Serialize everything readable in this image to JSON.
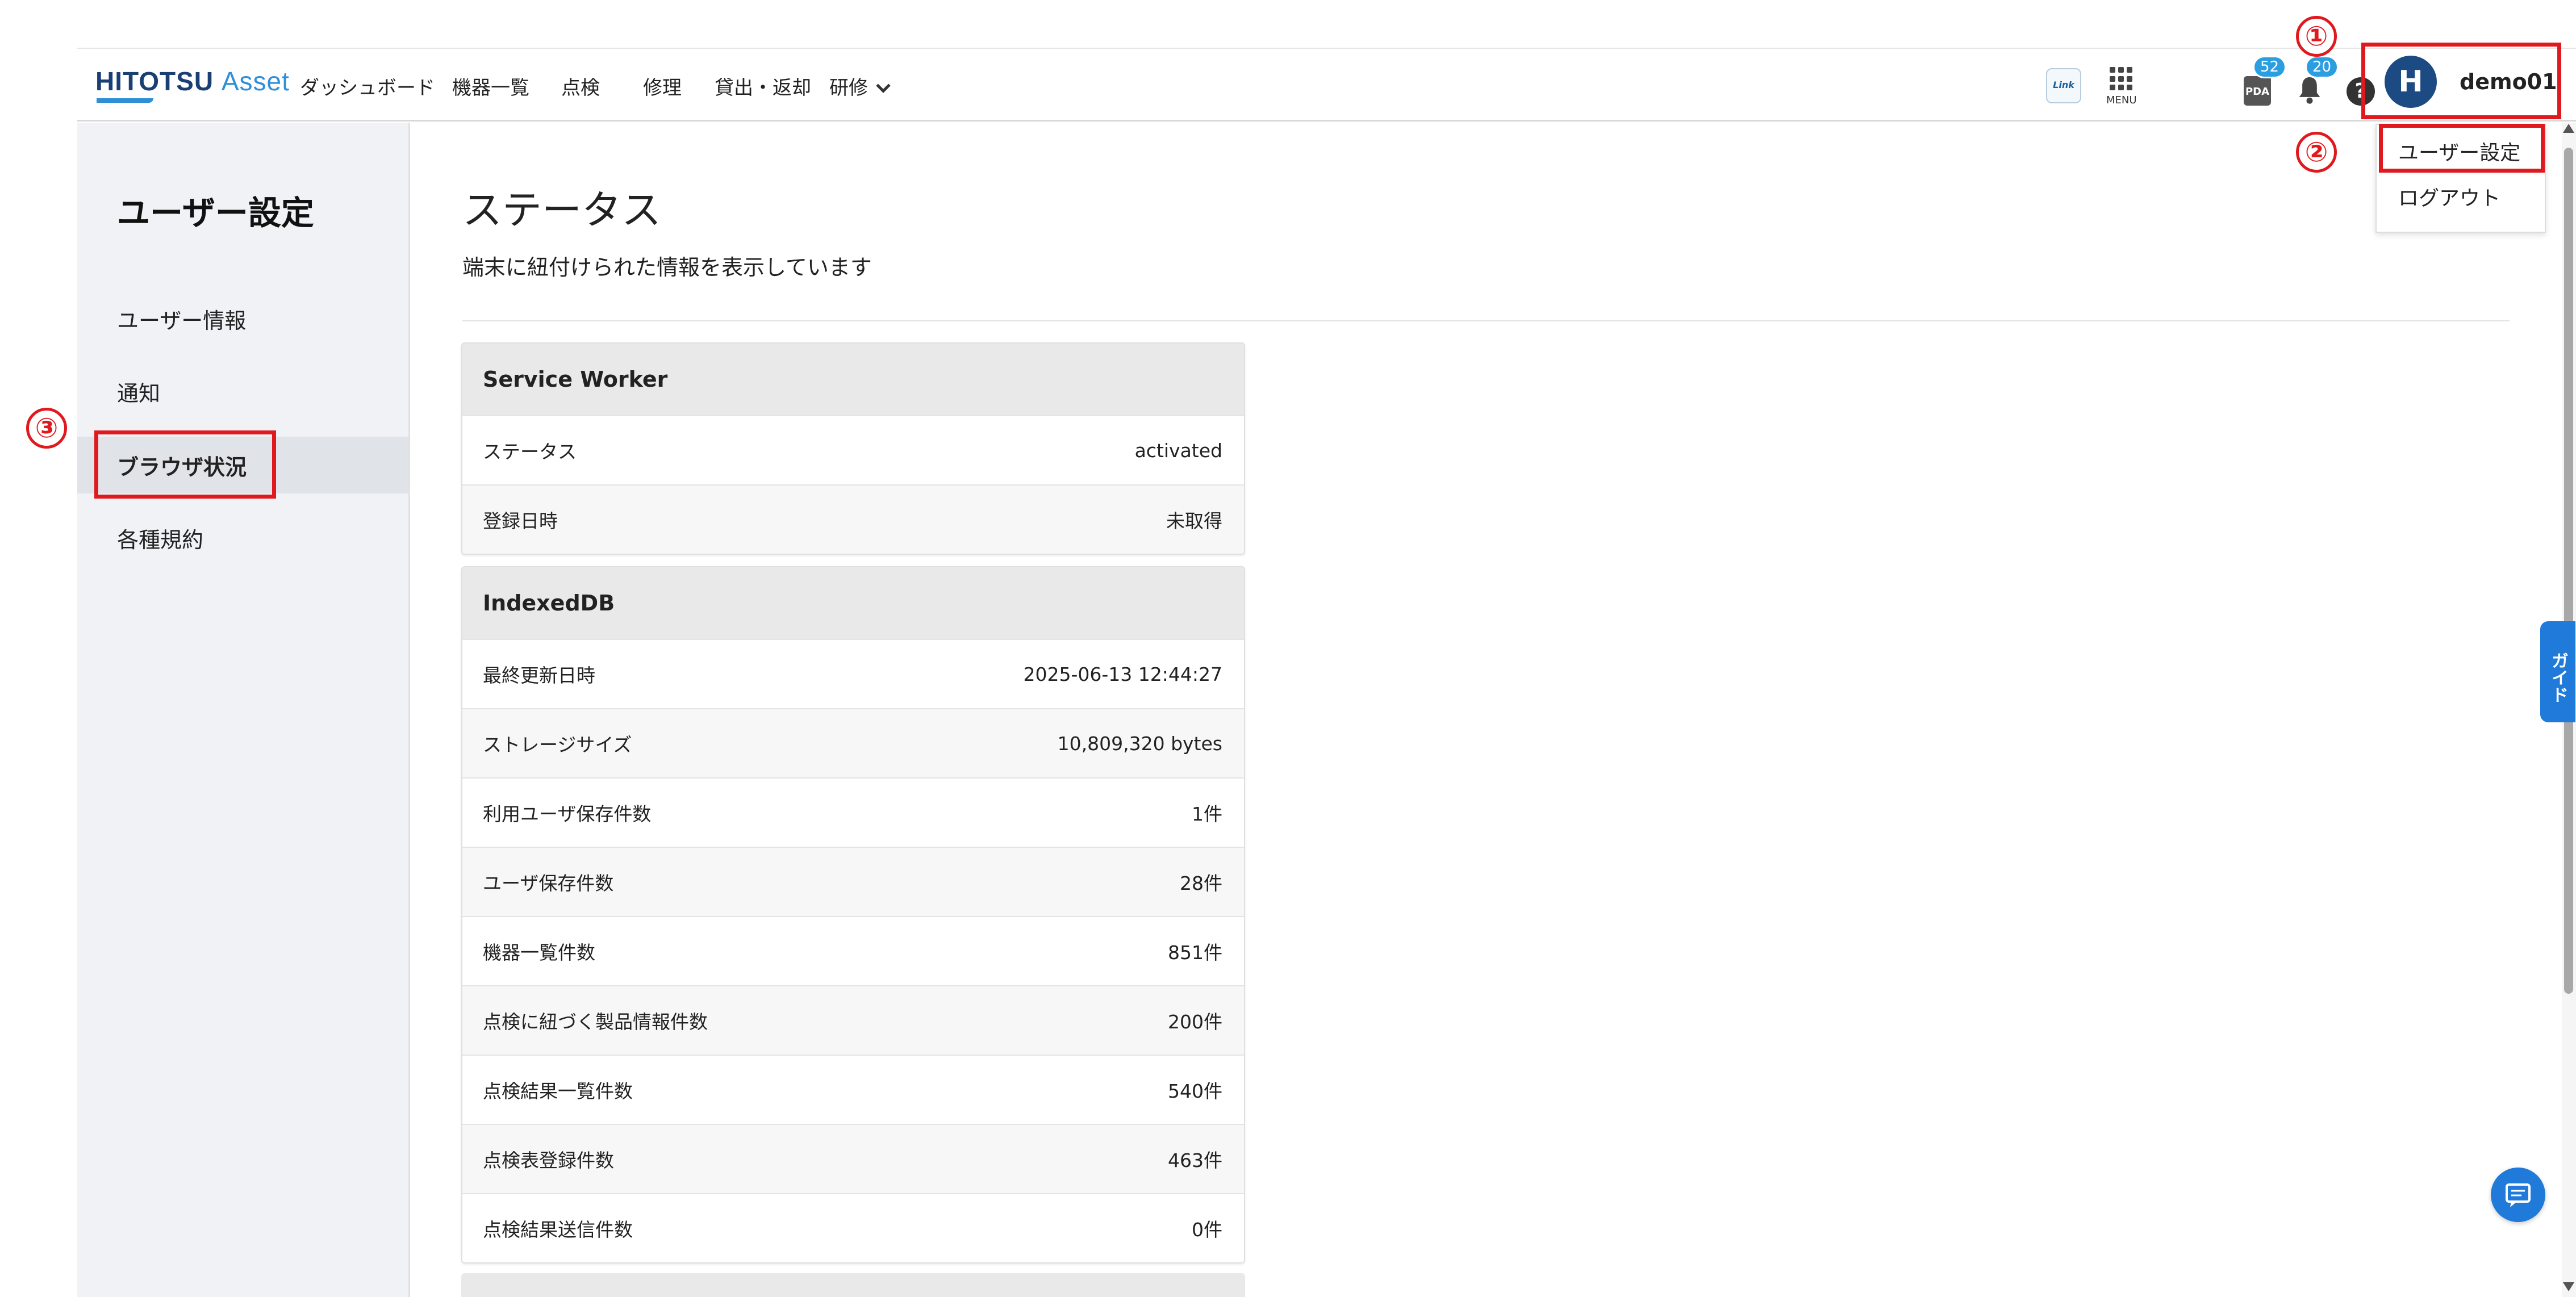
{
  "header": {
    "logo_main": "HITOTSU",
    "logo_accent": "Asset",
    "nav": [
      "ダッシュボード",
      "機器一覧",
      "点検",
      "修理",
      "貸出・返却",
      "研修"
    ],
    "link_label": "Link",
    "menu_label": "MENU",
    "pda_label": "PDA",
    "pda_badge": "52",
    "notify_badge": "20",
    "help_label": "?",
    "user_initial": "H",
    "username": "demo01"
  },
  "dropdown": {
    "items": [
      "ユーザー設定",
      "ログアウト"
    ]
  },
  "markers": [
    "①",
    "②",
    "③"
  ],
  "sidebar": {
    "title": "ユーザー設定",
    "items": [
      "ユーザー情報",
      "通知",
      "ブラウザ状況",
      "各種規約"
    ]
  },
  "main": {
    "title": "ステータス",
    "description": "端末に紐付けられた情報を表示しています"
  },
  "service_worker": {
    "title": "Service Worker",
    "rows": [
      {
        "label": "ステータス",
        "value": "activated"
      },
      {
        "label": "登録日時",
        "value": "未取得"
      }
    ]
  },
  "indexeddb": {
    "title": "IndexedDB",
    "rows": [
      {
        "label": "最終更新日時",
        "value": "2025-06-13 12:44:27"
      },
      {
        "label": "ストレージサイズ",
        "value": "10,809,320 bytes"
      },
      {
        "label": "利用ユーザ保存件数",
        "value": "1件"
      },
      {
        "label": "ユーザ保存件数",
        "value": "28件"
      },
      {
        "label": "機器一覧件数",
        "value": "851件"
      },
      {
        "label": "点検に紐づく製品情報件数",
        "value": "200件"
      },
      {
        "label": "点検結果一覧件数",
        "value": "540件"
      },
      {
        "label": "点検表登録件数",
        "value": "463件"
      },
      {
        "label": "点検結果送信件数",
        "value": "0件"
      }
    ]
  },
  "guide_label": "ガイド",
  "colors": {
    "accent": "#1f7ad9",
    "highlight": "#e0191e",
    "brand": "#1a3f74"
  }
}
